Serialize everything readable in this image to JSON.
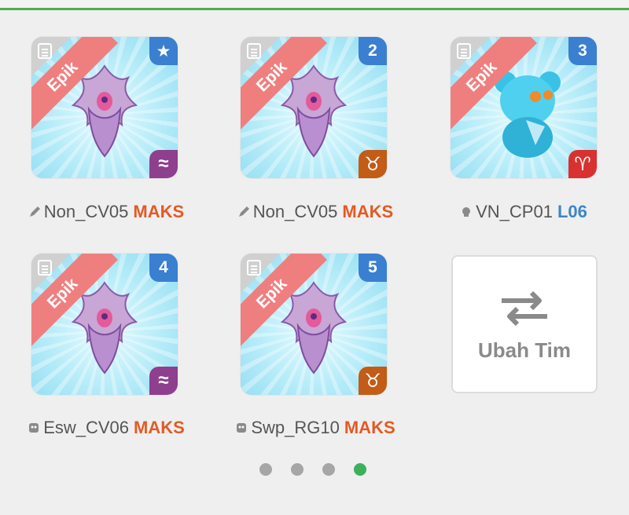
{
  "cards": [
    {
      "rarity": "Epik",
      "badge": "★",
      "badge_icon": "star-icon",
      "element": "≈",
      "element_icon": "wave-icon",
      "element_color": "#8e3f8e",
      "owner": "Non_CV05",
      "tag_icon": "pen-icon",
      "level": "MAKS",
      "level_color": "#e35a24"
    },
    {
      "rarity": "Epik",
      "badge": "2",
      "badge_icon": "number-badge",
      "element": "♉",
      "element_icon": "taurus-icon",
      "element_color": "#c25c16",
      "owner": "Non_CV05",
      "tag_icon": "pen-icon",
      "level": "MAKS",
      "level_color": "#e35a24"
    },
    {
      "rarity": "Epik",
      "badge": "3",
      "badge_icon": "number-badge",
      "element": "♈",
      "element_icon": "aries-icon",
      "element_color": "#d93030",
      "owner": "VN_CP01",
      "tag_icon": "skull-icon",
      "level": "L06",
      "level_color": "#3b86c8"
    },
    {
      "rarity": "Epik",
      "badge": "4",
      "badge_icon": "number-badge",
      "element": "≈",
      "element_icon": "wave-icon",
      "element_color": "#8e3f8e",
      "owner": "Esw_CV06",
      "tag_icon": "mask-icon",
      "level": "MAKS",
      "level_color": "#e35a24"
    },
    {
      "rarity": "Epik",
      "badge": "5",
      "badge_icon": "number-badge",
      "element": "♉",
      "element_icon": "taurus-icon",
      "element_color": "#c25c16",
      "owner": "Swp_RG10",
      "tag_icon": "mask-icon",
      "level": "MAKS",
      "level_color": "#e35a24"
    }
  ],
  "swap": {
    "label": "Ubah Tim",
    "icon": "swap-arrows-icon"
  },
  "pagination": {
    "count": 4,
    "active_index": 3
  }
}
